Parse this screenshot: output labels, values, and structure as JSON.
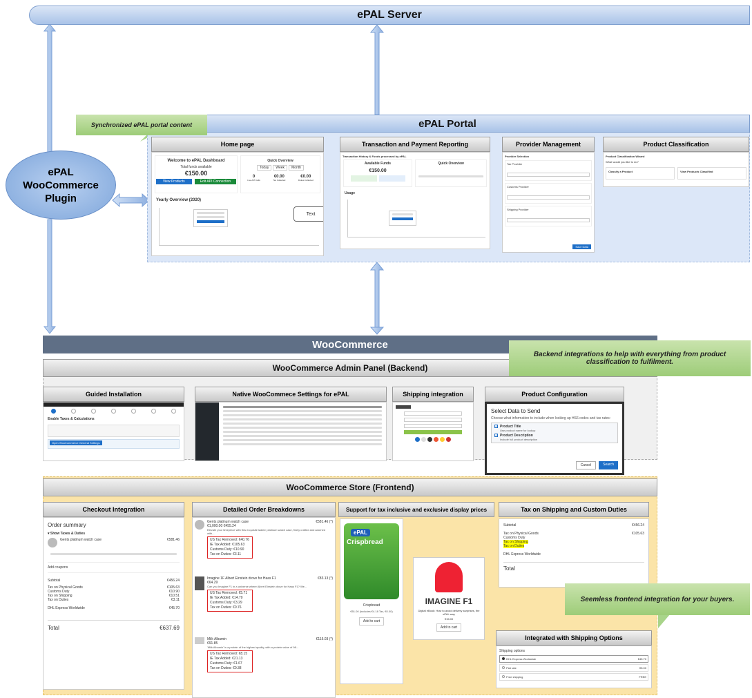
{
  "server": {
    "title": "ePAL Server"
  },
  "portal": {
    "title": "ePAL Portal",
    "note": "Synchronized ePAL portal content",
    "panels": {
      "home": "Home page",
      "transactions": "Transaction and Payment Reporting",
      "provider": "Provider Management",
      "classification": "Product  Classification"
    },
    "home_shot": {
      "welcome": "Welcome to ePAL Dashboard",
      "total_label": "Total funds available",
      "amount": "€150.00",
      "btn_products": "View Products",
      "btn_connect": "Edit API Connection",
      "quick_overview": "Quick Overview",
      "filters": [
        "Today",
        "Week",
        "Month"
      ],
      "stats": [
        {
          "value": "0",
          "label": "Live API Calls"
        },
        {
          "value": "€0.00",
          "label": "Tax Collected"
        },
        {
          "value": "€0.00",
          "label": "Duties Collected"
        }
      ],
      "yearly": "Yearly Overview (2020)",
      "text_box": "Text"
    },
    "tx_shot": {
      "header": "Transaction History & Funds processed by ePAL",
      "available": "Available Funds",
      "amount": "€150.00",
      "quick_overview": "Quick Overview",
      "usage": "Usage"
    },
    "provider_shot": {
      "title": "Provider Selection",
      "tax": "Tax Provider",
      "customs": "Customs Provider",
      "shipping": "Shipping Provider",
      "save": "Save Data"
    },
    "class_shot": {
      "title": "Product Classification Wizard",
      "q": "What would you like to do?",
      "opt1": "Classify a Product",
      "opt2": "View Products Classified"
    }
  },
  "plugin": {
    "title": "ePAL WooCommerce Plugin"
  },
  "woo": {
    "title": "WooCommerce",
    "note": "Backend integrations to help with everything from product classification to fulfilment.",
    "admin_title": "WooCommerce Admin Panel (Backend)",
    "admin_panels": {
      "install": "Guided Installation",
      "settings": "Native WooCommece Settings for ePAL",
      "shipping": "Shipping integration",
      "config": "Product Configuration"
    },
    "install_shot": {
      "heading": "Enable Taxes & Calculations",
      "btn": "Open WooCommerce General Settings"
    },
    "config_shot": {
      "title": "Select Data to Send",
      "desc": "Choose what information to include when looking up HS6 codes and tax rates:",
      "opt1_title": "Product Title",
      "opt1_desc": "Use product name for lookup",
      "opt2_title": "Product Description",
      "opt2_desc": "Include full product description",
      "cancel": "Cancel",
      "search": "Search"
    },
    "store_title": "WooCommerce Store (Frontend)",
    "store_panels": {
      "checkout": "Checkout Integration",
      "breakdown": "Detailed Order Breakdowns",
      "prices": "Support for tax inclusive and exclusive display prices",
      "tax_shipping": "Tax on Shipping and Custom Duties",
      "shipping_options": "Integrated with Shipping Options"
    },
    "store_note": "Seemless frontend integration for your buyers.",
    "checkout_shot": {
      "title": "Order summary",
      "taxes_toggle": "▾ Show Taxes & Duties",
      "item": "Gents platinum watch case",
      "item_price": "€581.46",
      "coupons": "Add coupons",
      "rows": [
        {
          "label": "Subtotal",
          "value": "€456.24"
        },
        {
          "label": "Tax on Physical Goods",
          "value": "€105.63"
        },
        {
          "label": "Customs Duty",
          "value": "€10.90"
        },
        {
          "label": "Tax on Shipping",
          "value": "€10.51"
        },
        {
          "label": "Tax on Duties",
          "value": "€3.11"
        },
        {
          "label": "DHL Express Worldwide",
          "value": "€45.70"
        }
      ],
      "total_label": "Total",
      "total_value": "€637.69"
    },
    "breakdown_shot": {
      "items": [
        {
          "qty": "1",
          "name": "Gents platinum watch case",
          "price": "€581.46 (*)",
          "sub": "€1,000.00 €455.24",
          "desc": "Elevate your timepiece with this exquisite ladies' platinum watch case, finely crafted and adorned with...",
          "taxes": [
            "US Tax Removed: €40.76",
            "IE Tax Added: €105.63",
            "Customs Duty: €10.90",
            "Tax on Duties: €3.11"
          ]
        },
        {
          "qty": "1",
          "name": "Imagine 1F Albert Einstein drove for Haas F1",
          "price": "€83.13 (*)",
          "sub": "€64.29",
          "desc": "Can you Imagine F1 in a universe where Albert Einstein drove for Haas F1? We...",
          "taxes": [
            "US Tax Removed: €5.71",
            "IE Tax Added: €14.79",
            "Customs Duty: €3.29",
            "Tax on Duties: €0.76"
          ]
        },
        {
          "qty": "1",
          "name": "Milk Albumin",
          "price": "€115.03 (*)",
          "sub": "€91.85",
          "desc": "'Milk Albumin' is a protein of the highest quality, with a protein value of 98...",
          "taxes": [
            "US Tax Removed: €8.15",
            "IE Tax Added: €21.13",
            "Customs Duty: €1.67",
            "Tax on Duties: €0.38"
          ]
        }
      ]
    },
    "prices_shot": {
      "product1_brand": "ePAL",
      "product1_name": "Crispbread",
      "product1_caption": "Crispbread",
      "product1_price": "€51.00 (includes €4.18 Tax, €0.00)",
      "product2_name": "IMAGINE F1",
      "product2_caption": "Digital eBook: How to avoid delivery surprises, the ePAL way",
      "product2_price": "€15.00",
      "add_cart": "Add to cart"
    },
    "tax_shot": {
      "rows": [
        {
          "label": "Subtotal",
          "value": "€456.24"
        },
        {
          "label": "Tax on Physical Goods",
          "value": "€105.63"
        },
        {
          "label": "Customs Duty",
          "value": ""
        },
        {
          "label": "Tax on Shipping",
          "value": ""
        },
        {
          "label": "Tax on Duties",
          "value": ""
        },
        {
          "label": "DHL Express Worldwide",
          "value": ""
        }
      ],
      "total_label": "Total"
    },
    "ship_shot": {
      "title": "Shipping options",
      "options": [
        {
          "name": "DHL Express Worldwide",
          "price": "€45.70"
        },
        {
          "name": "Flat rate",
          "price": "€5.00"
        },
        {
          "name": "Free shipping",
          "price": "FREE"
        }
      ]
    }
  },
  "colors": {
    "blue_bar": "#a9c3e8",
    "woo_bar": "#5f6f86",
    "portal_bg": "#dce7f8",
    "store_bg": "#fbe4a8",
    "note_green": "#a8d48a",
    "btn_blue": "#1e6fc8"
  }
}
